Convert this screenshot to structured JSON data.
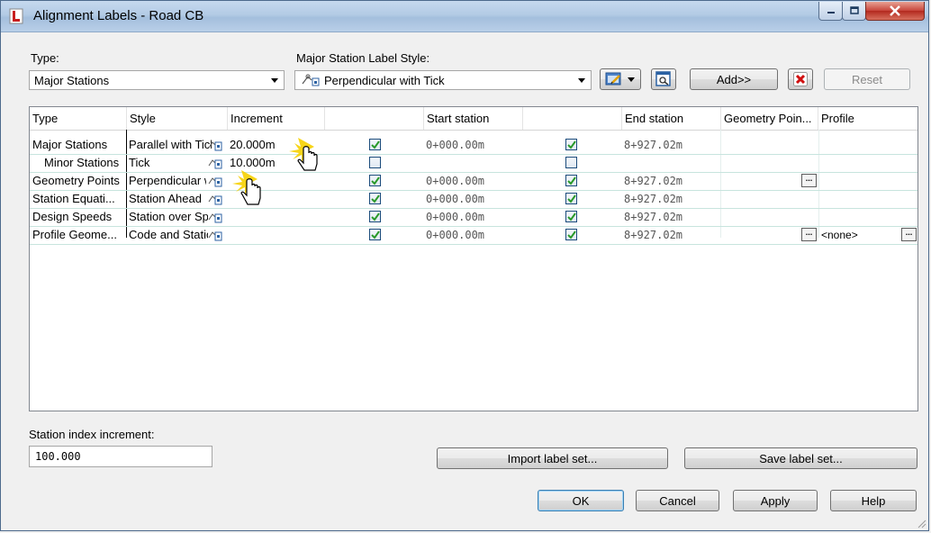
{
  "window": {
    "title": "Alignment Labels - Road CB"
  },
  "type_field": {
    "label": "Type:",
    "value": "Major Stations"
  },
  "style_field": {
    "label": "Major Station Label Style:",
    "value": "Perpendicular with Tick"
  },
  "toolbar": {
    "add_label": "Add>>",
    "reset_label": "Reset"
  },
  "grid": {
    "columns": [
      "Type",
      "Style",
      "Increment",
      "",
      "Start station",
      "",
      "End station",
      "Geometry Poin...",
      "Profile"
    ],
    "rows": [
      {
        "type": "Major Stations",
        "style": "Parallel with Tick",
        "increment": "20.000m",
        "start_checked": true,
        "start": "0+000.00m",
        "end_checked": true,
        "end": "8+927.02m",
        "geometry": "",
        "profile": ""
      },
      {
        "type": "Minor Stations",
        "style": "Tick",
        "increment": "10.000m",
        "start_checked": false,
        "start": "",
        "end_checked": false,
        "end": "",
        "geometry": "",
        "profile": ""
      },
      {
        "type": "Geometry Points",
        "style": "Perpendicular with Tick",
        "increment": "",
        "start_checked": true,
        "start": "0+000.00m",
        "end_checked": true,
        "end": "8+927.02m",
        "geometry": "...",
        "profile": ""
      },
      {
        "type": "Station Equati...",
        "style": "Station Ahead",
        "increment": "",
        "start_checked": true,
        "start": "0+000.00m",
        "end_checked": true,
        "end": "8+927.02m",
        "geometry": "",
        "profile": ""
      },
      {
        "type": "Design Speeds",
        "style": "Station over Speed",
        "increment": "",
        "start_checked": true,
        "start": "0+000.00m",
        "end_checked": true,
        "end": "8+927.02m",
        "geometry": "",
        "profile": ""
      },
      {
        "type": "Profile Geome...",
        "style": "Code and Station",
        "increment": "",
        "start_checked": true,
        "start": "0+000.00m",
        "end_checked": true,
        "end": "8+927.02m",
        "geometry": "...",
        "profile": "<none>"
      }
    ]
  },
  "station_index": {
    "label": "Station index increment:",
    "value": "100.000"
  },
  "buttons": {
    "import": "Import label set...",
    "save": "Save label set...",
    "ok": "OK",
    "cancel": "Cancel",
    "apply": "Apply",
    "help": "Help"
  },
  "colors": {
    "title_bar": "#b3cbe5",
    "close_button": "#c7443a",
    "check_green": "#2a9a2a",
    "grid_row_line": "#c7e4de",
    "delete_red": "#d01010"
  },
  "icons": [
    "app-icon",
    "minimize-icon",
    "maximize-icon",
    "close-icon",
    "dropdown-arrow-icon",
    "label-style-icon",
    "edit-style-icon",
    "browse-style-icon",
    "delete-icon",
    "checkbox-icon",
    "ellipsis-icon",
    "hand-cursor-icon"
  ]
}
